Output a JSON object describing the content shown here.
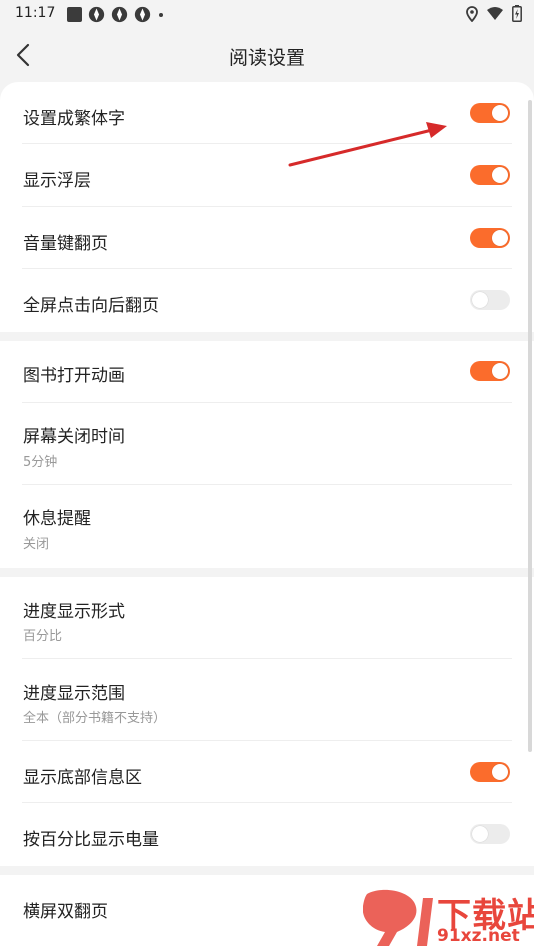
{
  "status_bar": {
    "time": "11:17"
  },
  "header": {
    "title": "阅读设置"
  },
  "sections": [
    {
      "rows": [
        {
          "label": "设置成繁体字",
          "toggle": "on"
        },
        {
          "label": "显示浮层",
          "toggle": "on"
        },
        {
          "label": "音量键翻页",
          "toggle": "on"
        },
        {
          "label": "全屏点击向后翻页",
          "toggle": "off"
        }
      ]
    },
    {
      "rows": [
        {
          "label": "图书打开动画",
          "toggle": "on"
        },
        {
          "label": "屏幕关闭时间",
          "value": "5分钟"
        },
        {
          "label": "休息提醒",
          "value": "关闭"
        }
      ]
    },
    {
      "rows": [
        {
          "label": "进度显示形式",
          "value": "百分比"
        },
        {
          "label": "进度显示范围",
          "value": "全本（部分书籍不支持）"
        },
        {
          "label": "显示底部信息区",
          "toggle": "on"
        },
        {
          "label": "按百分比显示电量",
          "toggle": "off"
        }
      ]
    },
    {
      "rows": [
        {
          "label": "横屏双翻页"
        }
      ]
    }
  ],
  "watermark": {
    "text": "下载站",
    "sub": "91xz.net"
  },
  "colors": {
    "accent": "#fb6c2c",
    "toggle_off": "#ececec",
    "background": "#f3f3f3",
    "arrow": "#d62a2a"
  }
}
